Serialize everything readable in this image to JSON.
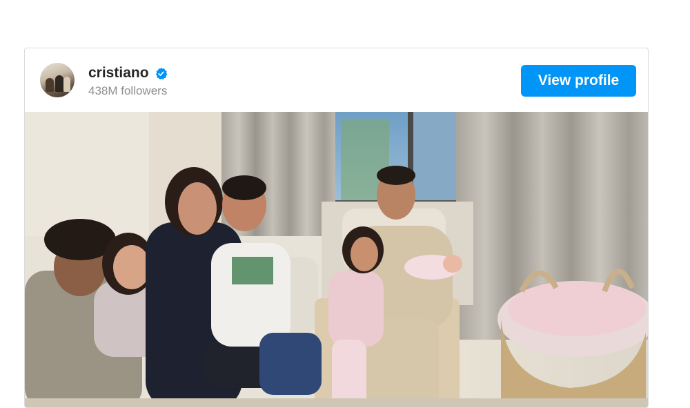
{
  "embed": {
    "username": "cristiano",
    "followers": "438M followers",
    "view_profile_label": "View profile",
    "icons": {
      "verified": "verified-badge-icon",
      "avatar": "profile-avatar"
    },
    "colors": {
      "button": "#0095f6",
      "verified": "#0095f6",
      "username": "#262626",
      "followers": "#8e8e8e"
    }
  }
}
